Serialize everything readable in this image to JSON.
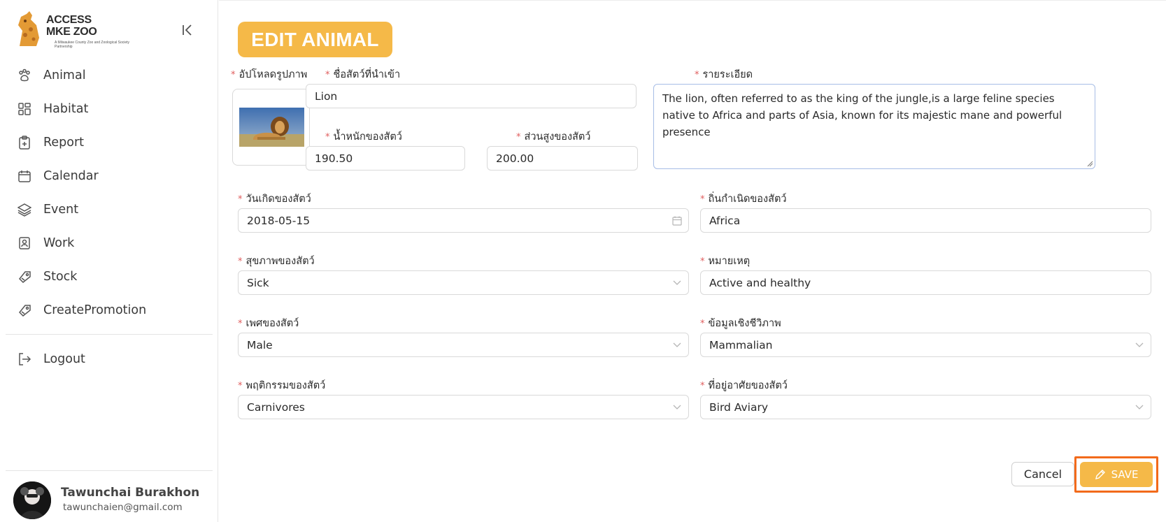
{
  "brand": {
    "logo_title_line1": "ACCESS",
    "logo_title_line2": "MKE ZOO",
    "logo_subtitle": "A Milwaukee County Zoo and Zoological Society Partnership",
    "accent_color": "#f5b948",
    "highlight_color": "#f26a1b"
  },
  "sidebar": {
    "items": [
      {
        "label": "Animal",
        "icon": "paw-icon"
      },
      {
        "label": "Habitat",
        "icon": "grid-icon"
      },
      {
        "label": "Report",
        "icon": "clipboard-icon"
      },
      {
        "label": "Calendar",
        "icon": "calendar-icon"
      },
      {
        "label": "Event",
        "icon": "layers-icon"
      },
      {
        "label": "Work",
        "icon": "badge-icon"
      },
      {
        "label": "Stock",
        "icon": "tag-icon"
      },
      {
        "label": "CreatePromotion",
        "icon": "tag-icon"
      }
    ],
    "logout_label": "Logout"
  },
  "user": {
    "name": "Tawunchai Burakhon",
    "email": "tawunchaien@gmail.com"
  },
  "page": {
    "title": "EDIT ANIMAL"
  },
  "form": {
    "upload_label": "อัปโหลดรูปภาพ",
    "name_label": "ชื่อสัตว์ที่นำเข้า",
    "name_value": "Lion",
    "weight_label": "น้ำหนักของสัตว์",
    "weight_value": "190.50",
    "height_label": "ส่วนสูงของสัตว์",
    "height_value": "200.00",
    "detail_label": "รายระเอียด",
    "detail_value": "The lion, often referred to as the king of the jungle,is a large feline species native to Africa and parts of Asia, known for its majestic mane and powerful presence",
    "birthdate_label": "วันเกิดของสัตว์",
    "birthdate_value": "2018-05-15",
    "origin_label": "ถิ่นกำเนิดของสัตว์",
    "origin_value": "Africa",
    "health_label": "สุขภาพของสัตว์",
    "health_value": "Sick",
    "note_label": "หมายเหตุ",
    "note_value": "Active and healthy",
    "sex_label": "เพศของสัตว์",
    "sex_value": "Male",
    "bio_label": "ข้อมูลเชิงชีวิภาพ",
    "bio_value": "Mammalian",
    "behavior_label": "พฤติกรรมของสัตว์",
    "behavior_value": "Carnivores",
    "habitat_label": "ที่อยู่อาศัยของสัตว์",
    "habitat_value": "Bird Aviary",
    "required_mark": "*"
  },
  "actions": {
    "cancel_label": "Cancel",
    "save_label": "SAVE"
  }
}
